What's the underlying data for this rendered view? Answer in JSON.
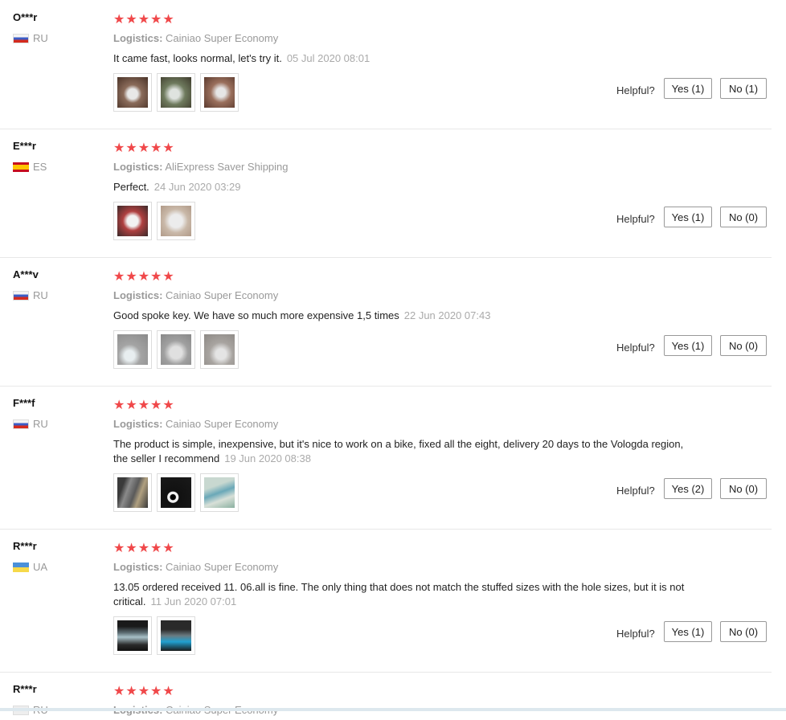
{
  "helpful_label": "Helpful?",
  "star_glyphs": "★★★★★",
  "logistics_label": "Logistics:",
  "reviews": [
    {
      "user": "O***r",
      "country": "RU",
      "flag": "ru",
      "logistics": "Cainiao Super Economy",
      "text": "It came fast, looks normal, let's try it.",
      "date": "05 Jul 2020 08:01",
      "yes": "Yes (1)",
      "no": "No (1)"
    },
    {
      "user": "E***r",
      "country": "ES",
      "flag": "es",
      "logistics": "AliExpress Saver Shipping",
      "text": "Perfect.",
      "date": "24 Jun 2020 03:29",
      "yes": "Yes (1)",
      "no": "No (0)"
    },
    {
      "user": "A***v",
      "country": "RU",
      "flag": "ru",
      "logistics": "Cainiao Super Economy",
      "text": "Good spoke key. We have so much more expensive 1,5 times",
      "date": "22 Jun 2020 07:43",
      "yes": "Yes (1)",
      "no": "No (0)"
    },
    {
      "user": "F***f",
      "country": "RU",
      "flag": "ru",
      "logistics": "Cainiao Super Economy",
      "text": "The product is simple, inexpensive, but it's nice to work on a bike, fixed all the eight, delivery 20 days to the Vologda region, the seller I recommend",
      "date": "19 Jun 2020 08:38",
      "yes": "Yes (2)",
      "no": "No (0)"
    },
    {
      "user": "R***r",
      "country": "UA",
      "flag": "ua",
      "logistics": "Cainiao Super Economy",
      "text": "13.05 ordered received 11. 06.all is fine. The only thing that does not match the stuffed sizes with the hole sizes, but it is not critical.",
      "date": "11 Jun 2020 07:01",
      "yes": "Yes (1)",
      "no": "No (0)"
    },
    {
      "user": "R***r",
      "country": "RU",
      "flag": "blank",
      "logistics": "Cainiao Super Economy"
    }
  ]
}
